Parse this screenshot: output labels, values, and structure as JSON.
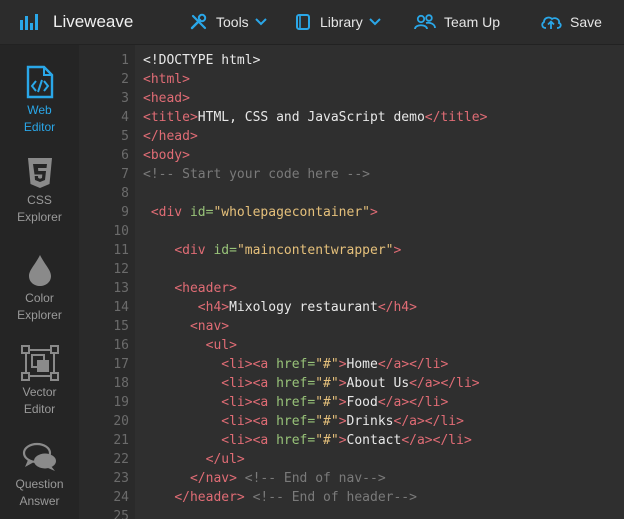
{
  "app": {
    "name": "Liveweave",
    "accent": "#2aa7e8"
  },
  "topnav": {
    "tools_label": "Tools",
    "library_label": "Library",
    "teamup_label": "Team Up",
    "save_label": "Save"
  },
  "sidebar": {
    "items": [
      {
        "line1": "Web",
        "line2": "Editor",
        "icon": "code-file-icon",
        "active": true
      },
      {
        "line1": "CSS",
        "line2": "Explorer",
        "icon": "css3-icon",
        "active": false
      },
      {
        "line1": "Color",
        "line2": "Explorer",
        "icon": "droplet-icon",
        "active": false
      },
      {
        "line1": "Vector",
        "line2": "Editor",
        "icon": "vector-shapes-icon",
        "active": false
      },
      {
        "line1": "Question",
        "line2": "Answer",
        "icon": "chat-bubbles-icon",
        "active": false
      }
    ]
  },
  "editor": {
    "lines": [
      {
        "n": "1",
        "indent": "",
        "tokens": [
          [
            "txt",
            "<!DOCTYPE html>"
          ]
        ]
      },
      {
        "n": "2",
        "indent": "",
        "tokens": [
          [
            "tag",
            "<html>"
          ]
        ]
      },
      {
        "n": "3",
        "indent": "",
        "tokens": [
          [
            "tag",
            "<head>"
          ]
        ]
      },
      {
        "n": "4",
        "indent": "",
        "tokens": [
          [
            "tag",
            "<title>"
          ],
          [
            "txt",
            "HTML, CSS and JavaScript demo"
          ],
          [
            "tag",
            "</title>"
          ]
        ]
      },
      {
        "n": "5",
        "indent": "",
        "tokens": [
          [
            "tag",
            "</head>"
          ]
        ]
      },
      {
        "n": "6",
        "indent": "",
        "tokens": [
          [
            "tag",
            "<body>"
          ]
        ]
      },
      {
        "n": "7",
        "indent": "",
        "tokens": [
          [
            "cmt",
            "<!-- Start your code here -->"
          ]
        ]
      },
      {
        "n": "8",
        "indent": "",
        "tokens": []
      },
      {
        "n": "9",
        "indent": " ",
        "tokens": [
          [
            "tag",
            "<div "
          ],
          [
            "attr",
            "id="
          ],
          [
            "str",
            "\"wholepagecontainer\""
          ],
          [
            "tag",
            ">"
          ]
        ]
      },
      {
        "n": "10",
        "indent": "",
        "tokens": []
      },
      {
        "n": "11",
        "indent": "    ",
        "tokens": [
          [
            "tag",
            "<div "
          ],
          [
            "attr",
            "id="
          ],
          [
            "str",
            "\"maincontentwrapper\""
          ],
          [
            "tag",
            ">"
          ]
        ]
      },
      {
        "n": "12",
        "indent": "",
        "tokens": []
      },
      {
        "n": "13",
        "indent": "    ",
        "tokens": [
          [
            "tag",
            "<header>"
          ]
        ]
      },
      {
        "n": "14",
        "indent": "       ",
        "tokens": [
          [
            "tag",
            "<h4>"
          ],
          [
            "txt",
            "Mixology restaurant"
          ],
          [
            "tag",
            "</h4>"
          ]
        ]
      },
      {
        "n": "15",
        "indent": "      ",
        "tokens": [
          [
            "tag",
            "<nav>"
          ]
        ]
      },
      {
        "n": "16",
        "indent": "        ",
        "tokens": [
          [
            "tag",
            "<ul>"
          ]
        ]
      },
      {
        "n": "17",
        "indent": "          ",
        "tokens": [
          [
            "tag",
            "<li><a "
          ],
          [
            "attr",
            "href="
          ],
          [
            "str",
            "\"#\""
          ],
          [
            "tag",
            ">"
          ],
          [
            "txt",
            "Home"
          ],
          [
            "tag",
            "</a></li>"
          ]
        ]
      },
      {
        "n": "18",
        "indent": "          ",
        "tokens": [
          [
            "tag",
            "<li><a "
          ],
          [
            "attr",
            "href="
          ],
          [
            "str",
            "\"#\""
          ],
          [
            "tag",
            ">"
          ],
          [
            "txt",
            "About Us"
          ],
          [
            "tag",
            "</a></li>"
          ]
        ]
      },
      {
        "n": "19",
        "indent": "          ",
        "tokens": [
          [
            "tag",
            "<li><a "
          ],
          [
            "attr",
            "href="
          ],
          [
            "str",
            "\"#\""
          ],
          [
            "tag",
            ">"
          ],
          [
            "txt",
            "Food"
          ],
          [
            "tag",
            "</a></li>"
          ]
        ]
      },
      {
        "n": "20",
        "indent": "          ",
        "tokens": [
          [
            "tag",
            "<li><a "
          ],
          [
            "attr",
            "href="
          ],
          [
            "str",
            "\"#\""
          ],
          [
            "tag",
            ">"
          ],
          [
            "txt",
            "Drinks"
          ],
          [
            "tag",
            "</a></li>"
          ]
        ]
      },
      {
        "n": "21",
        "indent": "          ",
        "tokens": [
          [
            "tag",
            "<li><a "
          ],
          [
            "attr",
            "href="
          ],
          [
            "str",
            "\"#\""
          ],
          [
            "tag",
            ">"
          ],
          [
            "txt",
            "Contact"
          ],
          [
            "tag",
            "</a></li>"
          ]
        ]
      },
      {
        "n": "22",
        "indent": "        ",
        "tokens": [
          [
            "tag",
            "</ul>"
          ]
        ]
      },
      {
        "n": "23",
        "indent": "      ",
        "tokens": [
          [
            "tag",
            "</nav>"
          ],
          [
            "cmt",
            " <!-- End of nav-->"
          ]
        ]
      },
      {
        "n": "24",
        "indent": "    ",
        "tokens": [
          [
            "tag",
            "</header>"
          ],
          [
            "cmt",
            " <!-- End of header-->"
          ]
        ]
      },
      {
        "n": "25",
        "indent": "",
        "tokens": []
      }
    ]
  }
}
